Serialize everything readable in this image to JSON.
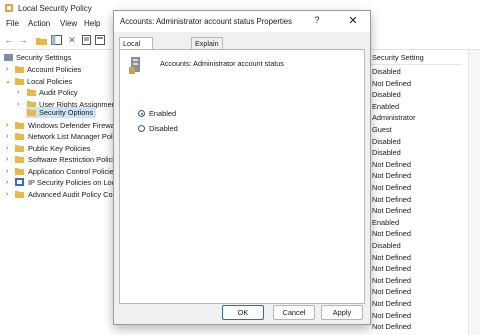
{
  "app": {
    "title": "Local Security Policy"
  },
  "menu": [
    {
      "label": "File"
    },
    {
      "label": "Action"
    },
    {
      "label": "View"
    },
    {
      "label": "Help"
    }
  ],
  "tree": {
    "items": [
      {
        "label": "Security Settings",
        "expanded": true
      },
      {
        "label": "Account Policies",
        "expanded": false
      },
      {
        "label": "Local Policies",
        "expanded": true
      },
      {
        "label": "Audit Policy",
        "expanded": false
      },
      {
        "label": "User Rights Assignment",
        "expanded": false
      },
      {
        "label": "Security Options",
        "selected": true
      },
      {
        "label": "Windows Defender Firewall",
        "expanded": false
      },
      {
        "label": "Network List Manager Poli",
        "expanded": false
      },
      {
        "label": "Public Key Policies",
        "expanded": false
      },
      {
        "label": "Software Restriction Policie",
        "expanded": false
      },
      {
        "label": "Application Control Policie",
        "expanded": false
      },
      {
        "label": "IP Security Policies on Loca",
        "expanded": false
      },
      {
        "label": "Advanced Audit Policy Co",
        "expanded": false
      }
    ]
  },
  "list": {
    "header": "Security Setting",
    "rows": [
      "Disabled",
      "Not Defined",
      "Disabled",
      "Enabled",
      "Administrator",
      "Guest",
      "Disabled",
      "Disabled",
      "Not Defined",
      "Not Defined",
      "Not Defined",
      "Not Defined",
      "Not Defined",
      "Enabled",
      "Not Defined",
      "Disabled",
      "Not Defined",
      "Not Defined",
      "Not Defined",
      "Not Defined",
      "Not Defined",
      "Not Defined",
      "Not Defined"
    ]
  },
  "dialog": {
    "title": "Accounts: Administrator account status Properties",
    "help_label": "?",
    "close_label": "✕",
    "tabs": [
      {
        "label": "Local Security Setting"
      },
      {
        "label": "Explain"
      }
    ],
    "policy_name": "Accounts: Administrator account status",
    "options": [
      {
        "label": "Enabled",
        "checked": true
      },
      {
        "label": "Disabled",
        "checked": false
      }
    ],
    "buttons": {
      "ok": "OK",
      "cancel": "Cancel",
      "apply": "Apply"
    }
  },
  "colors": {
    "accent": "#1f5fb4",
    "selection": "#cde4f7",
    "folder": "#e8b84a"
  }
}
